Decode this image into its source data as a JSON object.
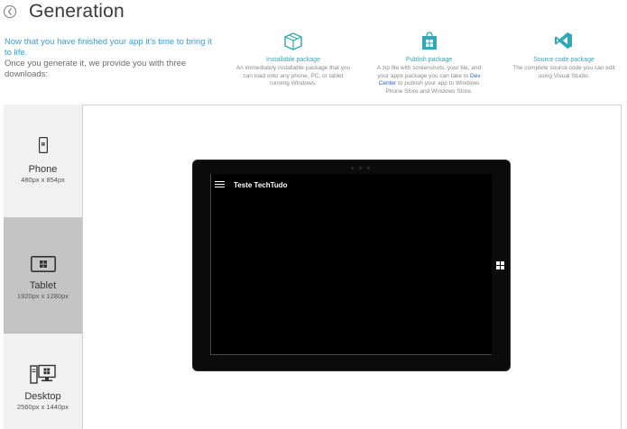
{
  "header": {
    "title": "Generation"
  },
  "intro": {
    "highlight": "Now that you have finished your app it's time to bring it to life.",
    "text": "Once you generate it, we provide you with three downloads:"
  },
  "downloads": [
    {
      "icon": "package-icon",
      "title": "Installable package",
      "desc": "An immediately installable package that you can load onto any phone, PC, or tablet running Windows."
    },
    {
      "icon": "store-bag-icon",
      "title": "Publish package",
      "desc_pre": "A zip file with screenshots, your tile, and your appx package you can take to ",
      "link": "Dev Center",
      "desc_post": " to publish your app to Windows Phone Store and Windows Store."
    },
    {
      "icon": "visual-studio-icon",
      "title": "Source code package",
      "desc": "The complete source code you can edit using Visual Studio."
    }
  ],
  "devices": [
    {
      "name": "Phone",
      "size": "480px x 854px",
      "icon": "phone-icon",
      "selected": false
    },
    {
      "name": "Tablet",
      "size": "1920px x 1280px",
      "icon": "tablet-icon",
      "selected": true
    },
    {
      "name": "Desktop",
      "size": "2560px x 1440px",
      "icon": "desktop-icon",
      "selected": false
    }
  ],
  "preview": {
    "app_title": "Teste TechTudo",
    "menu_icon": "hamburger-icon",
    "windows_icon": "windows-logo-icon"
  },
  "colors": {
    "accent_teal": "#2ea9b5",
    "intro_blue": "#3e9ad6",
    "link_blue": "#1f64c2",
    "selected_device_bg": "#c4c4c4",
    "screen_bg": "#000000"
  }
}
